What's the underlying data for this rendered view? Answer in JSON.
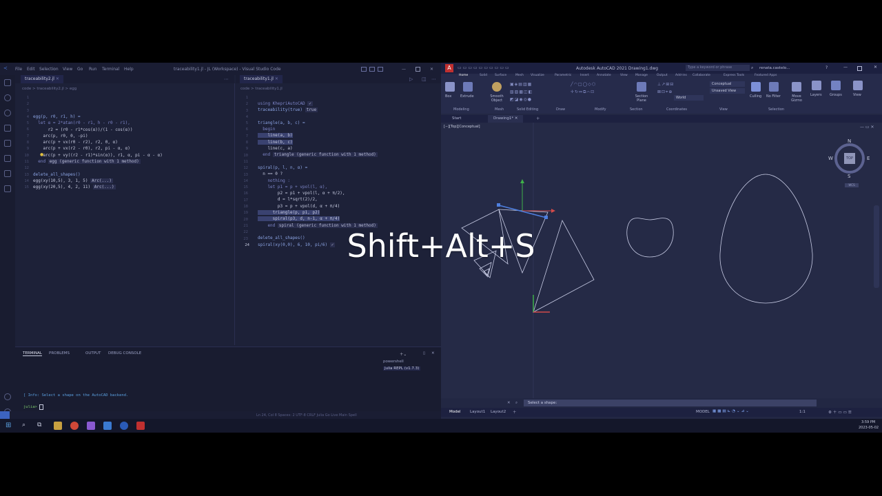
{
  "vscode": {
    "menu": [
      "File",
      "Edit",
      "Selection",
      "View",
      "Go",
      "Run",
      "Terminal",
      "Help"
    ],
    "window_title": "traceability1.jl - JL (Workspace) - Visual Studio Code",
    "left_tab": "traceability2.jl",
    "left_breadcrumb": "code > traceability2.jl > egg",
    "right_tab": "traceability1.jl",
    "right_breadcrumb": "code > traceability1.jl",
    "left_code": [
      "egg(p, r0, r1, h) =",
      "  let α = 2*atan(r0 - r1, h - r0 - r1),",
      "      r2 = (r0 - r1*cos(α))/(1 - cos(α))",
      "    arc(p, r0, 0, -pi)",
      "    arc(p + vx(r0 - r2), r2, 0, α)",
      "    arc(p + vx(r2 - r0), r2, pi - α, α)",
      "    arc(p + vy((r2 - r1)*sin(α)), r1, α, pi - α - α)",
      "  end",
      "",
      "delete_all_shapes()",
      "egg(xy(10,5), 3, 1, 5)",
      "egg(xy(20,5), 4, 2, 11)"
    ],
    "left_inline": {
      "egg_def": "egg (generic function with 1 method)",
      "arc1": "Arc(...)",
      "arc2": "Arc(...)"
    },
    "right_code": [
      "using KhepriAutoCAD",
      "traceability(true)",
      "",
      "triangle(a, b, c) =",
      "  begin",
      "    line(a, b)",
      "    line(b, c)",
      "    line(c, a)",
      "  end",
      "",
      "spiral(p, l, n, α) =",
      "  n == 0 ?",
      "    nothing :",
      "    let p1 = p + vpol(l, α),",
      "        p2 = p1 + vpol(l, α + π/2),",
      "        d = l*sqrt(2)/2,",
      "        p3 = p + vpol(d, α + π/4)",
      "      triangle(p, p1, p2)",
      "      spiral(p3, d, n-1, α + π/4)",
      "    end",
      "",
      "delete_all_shapes()",
      "spiral(xy(0,0), 6, 10, pi/6)"
    ],
    "right_inline": {
      "using": "✓",
      "traceability": "true",
      "triangle_def": "triangle (generic function with 1 method)",
      "spiral_def": "spiral (generic function with 1 method)",
      "spiral_call": "✓"
    },
    "right_current_line": "24",
    "left_current_line": "10",
    "panel_tabs": [
      "TERMINAL",
      "PROBLEMS",
      "OUTPUT",
      "DEBUG CONSOLE"
    ],
    "terminals": [
      "powershell",
      "Julia REPL (v1.7.3)"
    ],
    "terminal_info": "[ Info: Select a shape on the AutoCAD backend.",
    "terminal_prompt": "julia> ",
    "statusbar": "Ln 24, Col 8   Spaces: 2   UTF-8   CRLF   Julia   Go Live   Main   Spell"
  },
  "autocad": {
    "title": "Autodesk AutoCAD 2021   Drawing1.dwg",
    "search_placeholder": "Type a keyword or phrase",
    "user": "renata.castelo...",
    "ribbon_tabs": [
      "Home",
      "Solid",
      "Surface",
      "Mesh",
      "Visualize",
      "Parametric",
      "Insert",
      "Annotate",
      "View",
      "Manage",
      "Output",
      "Add-ins",
      "Collaborate",
      "Express Tools",
      "Featured Apps"
    ],
    "ribbon_buttons": [
      "Box",
      "Extrude",
      "Smooth Object",
      "Section Plane",
      "Culling",
      "No Filter",
      "Move Gizmo",
      "Layers",
      "Groups",
      "View"
    ],
    "ribbon_panels": [
      "Modeling",
      "Mesh",
      "Solid Editing",
      "Draw",
      "Modify",
      "Section",
      "Coordinates",
      "View",
      "Selection"
    ],
    "visual_style": "Conceptual",
    "view_preset": "Unsaved View",
    "ucs": "World",
    "doc_tabs": [
      "Start",
      "Drawing1*"
    ],
    "viewport_label": "[−][Top][Conceptual]",
    "viewcube": {
      "top": "TOP",
      "n": "N",
      "s": "S",
      "e": "E",
      "w": "W",
      "wcs": "WCS"
    },
    "command_prompt": "Select a shape:",
    "layout_tabs": [
      "Model",
      "Layout1",
      "Layout2"
    ],
    "status_model": "MODEL",
    "scale": "1:1"
  },
  "taskbar": {
    "time": "3:59 PM",
    "date": "2023-05-02"
  },
  "overlay_keys": "Shift+Alt+S",
  "colors": {
    "screen_bg": "#1b1f35",
    "shape_stroke": "#c9cde6",
    "axis_x": "#d24a4a",
    "axis_y": "#3fb24a",
    "selected": "#4e7fe0"
  }
}
